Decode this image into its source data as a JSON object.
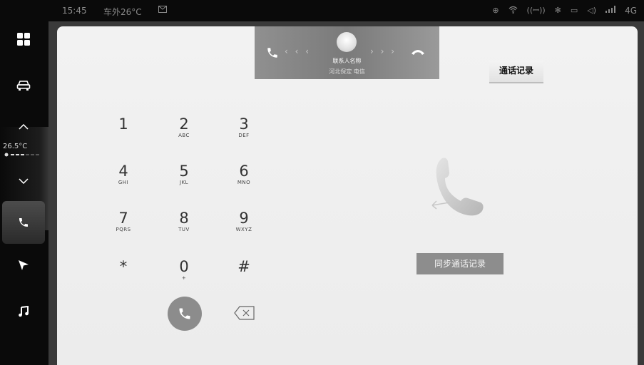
{
  "status_bar": {
    "time": "15:45",
    "outside_temp": "车外26°C",
    "network": "4G",
    "icons": [
      "message-icon",
      "bluetooth-device-icon",
      "wifi-icon",
      "hotspot-icon",
      "bluetooth-icon",
      "screen-icon",
      "volume-icon",
      "signal-icon"
    ]
  },
  "sidebar": {
    "items": [
      {
        "name": "apps",
        "icon": "apps-grid-icon"
      },
      {
        "name": "vehicle",
        "icon": "car-icon"
      },
      {
        "name": "temp-up",
        "icon": "chevron-up-icon"
      },
      {
        "name": "temp-down",
        "icon": "chevron-down-icon"
      },
      {
        "name": "phone",
        "icon": "phone-icon",
        "active": true
      },
      {
        "name": "navigation",
        "icon": "navigation-arrow-icon"
      },
      {
        "name": "music",
        "icon": "music-note-icon"
      }
    ],
    "temperature": "26.5°C"
  },
  "call_banner": {
    "contact_name": "联系人名称",
    "location_carrier": "河北保定 电信",
    "left_chevrons": "‹ ‹ ‹",
    "right_chevrons": "› › ›"
  },
  "call_history_button": "通话记录",
  "keypad": [
    {
      "digit": "1",
      "letters": ""
    },
    {
      "digit": "2",
      "letters": "ABC"
    },
    {
      "digit": "3",
      "letters": "DEF"
    },
    {
      "digit": "4",
      "letters": "GHI"
    },
    {
      "digit": "5",
      "letters": "JKL"
    },
    {
      "digit": "6",
      "letters": "MNO"
    },
    {
      "digit": "7",
      "letters": "PQRS"
    },
    {
      "digit": "8",
      "letters": "TUV"
    },
    {
      "digit": "9",
      "letters": "WXYZ"
    },
    {
      "digit": "*",
      "letters": ""
    },
    {
      "digit": "0",
      "letters": "+"
    },
    {
      "digit": "#",
      "letters": ""
    }
  ],
  "sync_button": "同步通话记录",
  "colors": {
    "sidebar_bg": "#0a0a0a",
    "card_bg": "#f0f0f0",
    "banner_bg": "#8a8a8a",
    "call_button": "#8c8c8c"
  }
}
